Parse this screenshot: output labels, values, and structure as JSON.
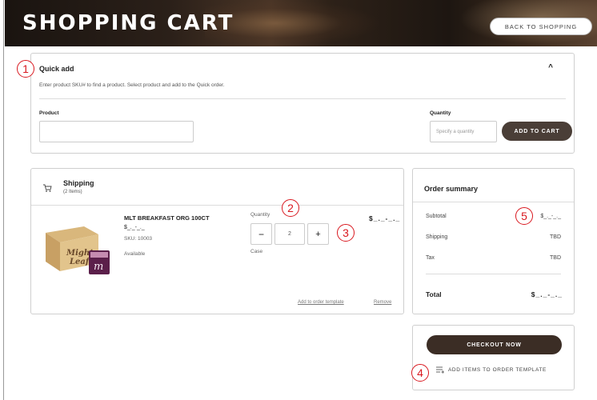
{
  "header": {
    "title": "SHOPPING CART",
    "back_button": "BACK TO SHOPPING"
  },
  "markers": [
    "1",
    "2",
    "3",
    "4",
    "5"
  ],
  "quick_add": {
    "title": "Quick add",
    "caret": "^",
    "description": "Enter product SKU# to find a product. Select product and add to the Quick order.",
    "product_label": "Product",
    "product_value": "",
    "quantity_label": "Quantity",
    "quantity_placeholder": "Specify a quantity",
    "add_button": "ADD TO CART"
  },
  "shipping": {
    "title": "Shipping",
    "count": "(2 Items)",
    "item": {
      "name": "MLT BREAKFAST ORG 100CT",
      "price": "$_._-_._",
      "sku": "SKU: 10003",
      "availability": "Available",
      "quantity_label": "Quantity",
      "quantity_value": "2",
      "minus": "−",
      "plus": "+",
      "unit": "Case",
      "line_total": "$_._-_._",
      "add_to_template": "Add to order template",
      "remove": "Remove"
    }
  },
  "summary": {
    "title": "Order summary",
    "rows": [
      {
        "label": "Subtotal",
        "value": "$_._-_._"
      },
      {
        "label": "Shipping",
        "value": "TBD"
      },
      {
        "label": "Tax",
        "value": "TBD"
      }
    ],
    "total_label": "Total",
    "total_value": "$_._-_._"
  },
  "checkout": {
    "button": "CHECKOUT NOW",
    "add_to_template": "ADD ITEMS TO ORDER TEMPLATE"
  },
  "icons": [
    "cart-icon",
    "order-template-icon",
    "chevron-up-icon"
  ],
  "colors": {
    "accent_dark": "#3b2d25",
    "button_brown": "#4a3e37",
    "marker_red": "#d9181f"
  }
}
